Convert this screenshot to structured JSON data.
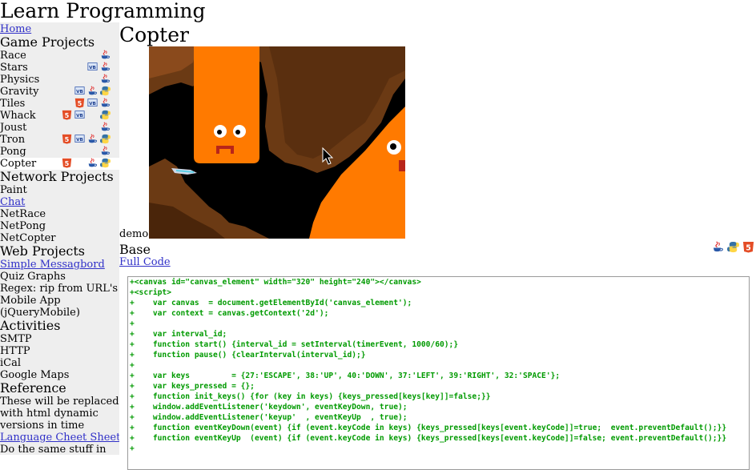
{
  "site": {
    "title": "Learn Programming"
  },
  "sidebar": {
    "home": "Home",
    "game_heading": "Game Projects",
    "games": [
      {
        "label": "Race"
      },
      {
        "label": "Stars"
      },
      {
        "label": "Physics"
      },
      {
        "label": "Gravity"
      },
      {
        "label": "Tiles"
      },
      {
        "label": "Whack"
      },
      {
        "label": "Joust"
      },
      {
        "label": "Tron"
      },
      {
        "label": "Pong"
      },
      {
        "label": "Copter"
      }
    ],
    "network_heading": "Network Projects",
    "network": {
      "paint": "Paint",
      "chat": "Chat",
      "netrace": "NetRace",
      "netpong": "NetPong",
      "netcopter": "NetCopter"
    },
    "web_heading": "Web Projects",
    "web": {
      "messageboard": "Simple Messagbord",
      "quiz": "Quiz Graphs",
      "regex": "Regex: rip from URL's",
      "mobile": "Mobile App (jQueryMobile)"
    },
    "activities_heading": "Activities",
    "activities": {
      "smtp": "SMTP",
      "http": "HTTP",
      "ical": "iCal",
      "maps": "Google Maps"
    },
    "reference_heading": "Reference",
    "reference": {
      "note": "These will be replaced with html dynamic versions in time",
      "cheat": "Language Cheet Sheet",
      "same": "Do the same stuff in"
    }
  },
  "main": {
    "title": "Copter",
    "demo_label": "demo",
    "section_title": "Base",
    "full_code": "Full Code",
    "code_lines": [
      "+<canvas id=\"canvas_element\" width=\"320\" height=\"240\"></canvas>",
      "+<script>",
      "+    var canvas  = document.getElementById('canvas_element');",
      "+    var context = canvas.getContext('2d');",
      "+",
      "+    var interval_id;",
      "+    function start() {interval_id = setInterval(timerEvent, 1000/60);}",
      "+    function pause() {clearInterval(interval_id);}",
      "+",
      "+    var keys         = {27:'ESCAPE', 38:'UP', 40:'DOWN', 37:'LEFT', 39:'RIGHT', 32:'SPACE'};",
      "+    var keys_pressed = {};",
      "+    function init_keys() {for (key in keys) {keys_pressed[keys[key]]=false;}}",
      "+    window.addEventListener('keydown', eventKeyDown, true);",
      "+    window.addEventListener('keyup'  , eventKeyUp  , true);",
      "+    function eventKeyDown(event) {if (event.keyCode in keys) {keys_pressed[keys[event.keyCode]]=true;  event.preventDefault();}}",
      "+    function eventKeyUp  (event) {if (event.keyCode in keys) {keys_pressed[keys[event.keyCode]]=false; event.preventDefault();}}",
      "+"
    ]
  },
  "icon_labels": {
    "vb": "VB",
    "html5": "5"
  },
  "colors": {
    "sidebar_bg": "#eeeeee",
    "link": "#3030c8",
    "code": "#009a00",
    "html5": "#e44d26",
    "game_orange": "#ff7a00",
    "cave_brown": "#6b3a14"
  }
}
